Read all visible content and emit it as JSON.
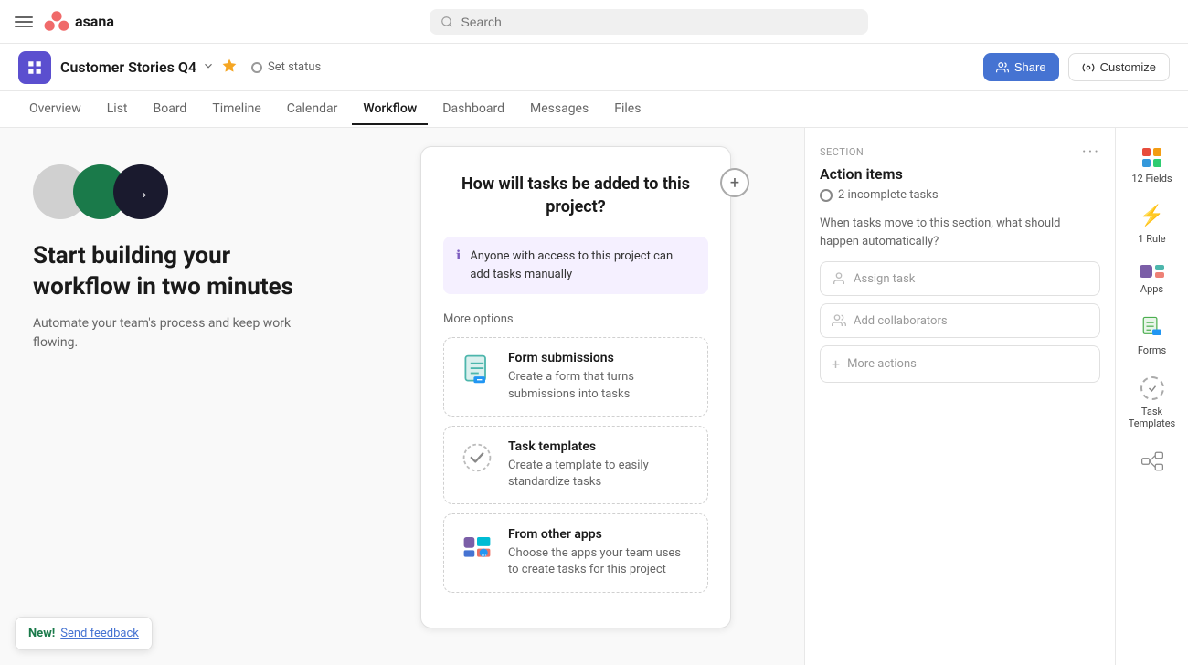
{
  "topbar": {
    "search_placeholder": "Search"
  },
  "project": {
    "name": "Customer Stories Q4",
    "set_status": "Set status",
    "share_label": "Share",
    "customize_label": "Customize"
  },
  "nav": {
    "tabs": [
      {
        "id": "overview",
        "label": "Overview"
      },
      {
        "id": "list",
        "label": "List"
      },
      {
        "id": "board",
        "label": "Board"
      },
      {
        "id": "timeline",
        "label": "Timeline"
      },
      {
        "id": "calendar",
        "label": "Calendar"
      },
      {
        "id": "workflow",
        "label": "Workflow",
        "active": true
      },
      {
        "id": "dashboard",
        "label": "Dashboard"
      },
      {
        "id": "messages",
        "label": "Messages"
      },
      {
        "id": "files",
        "label": "Files"
      }
    ]
  },
  "left_panel": {
    "title": "Start building your workflow in two minutes",
    "subtitle": "Automate your team's process and keep work flowing."
  },
  "center_panel": {
    "card_title": "How will tasks be added to this project?",
    "manual_option_text": "Anyone with access to this project can add tasks manually",
    "more_options_label": "More options",
    "options": [
      {
        "id": "form-submissions",
        "title": "Form submissions",
        "description": "Create a form that turns submissions into tasks"
      },
      {
        "id": "task-templates",
        "title": "Task templates",
        "description": "Create a template to easily standardize tasks"
      },
      {
        "id": "other-apps",
        "title": "From other apps",
        "description": "Choose the apps your team uses to create tasks for this project"
      }
    ]
  },
  "right_panel": {
    "section_label": "Section",
    "section_title": "Action items",
    "incomplete_tasks": "2 incomplete tasks",
    "question": "When tasks move to this section, what should happen automatically?",
    "assign_task_placeholder": "Assign task",
    "add_collaborators_placeholder": "Add collaborators",
    "more_actions_label": "More actions"
  },
  "icons_panel": {
    "items": [
      {
        "id": "fields",
        "label": "12 Fields"
      },
      {
        "id": "rules",
        "label": "1 Rule"
      },
      {
        "id": "apps",
        "label": "Apps"
      },
      {
        "id": "forms",
        "label": "Forms"
      },
      {
        "id": "task-templates",
        "label": "Task Templates"
      },
      {
        "id": "flow",
        "label": ""
      }
    ]
  },
  "feedback": {
    "new_label": "New!",
    "link_label": "Send feedback"
  }
}
